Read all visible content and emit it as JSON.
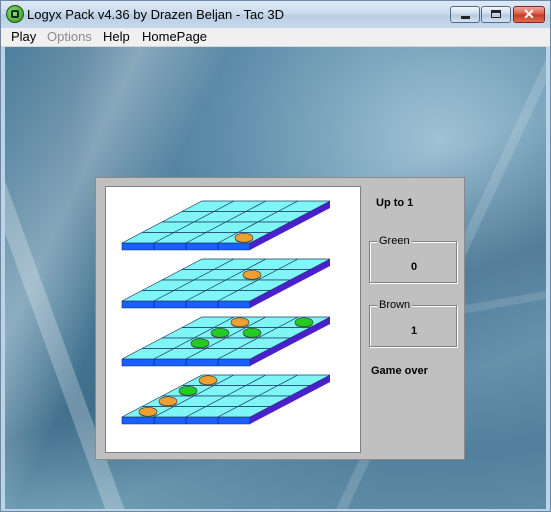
{
  "window": {
    "title": "Logyx Pack v4.36  by Drazen Beljan - Tac 3D"
  },
  "menu": [
    {
      "label": "Play",
      "enabled": true
    },
    {
      "label": "Options",
      "enabled": false
    },
    {
      "label": "Help",
      "enabled": true
    },
    {
      "label": "HomePage",
      "enabled": true
    }
  ],
  "game": {
    "goal_text": "Up to 1",
    "green": {
      "label": "Green",
      "score": "0"
    },
    "brown": {
      "label": "Brown",
      "score": "1"
    },
    "status_text": "Game over",
    "colors": {
      "board_top": "#7ff5f5",
      "board_front": "#1a5fff",
      "board_side": "#4a1fcc",
      "green_piece": "#22cc22",
      "brown_piece": "#f0a030"
    },
    "pieces": [
      {
        "layer": 0,
        "row": 3,
        "col": 3,
        "color": "brown"
      },
      {
        "layer": 1,
        "row": 1,
        "col": 2,
        "color": "brown"
      },
      {
        "layer": 2,
        "row": 0,
        "col": 1,
        "color": "brown"
      },
      {
        "layer": 2,
        "row": 1,
        "col": 1,
        "color": "green"
      },
      {
        "layer": 2,
        "row": 1,
        "col": 2,
        "color": "green"
      },
      {
        "layer": 2,
        "row": 0,
        "col": 3,
        "color": "green"
      },
      {
        "layer": 2,
        "row": 2,
        "col": 1,
        "color": "green"
      },
      {
        "layer": 3,
        "row": 0,
        "col": 0,
        "color": "brown"
      },
      {
        "layer": 3,
        "row": 1,
        "col": 0,
        "color": "green"
      },
      {
        "layer": 3,
        "row": 2,
        "col": 0,
        "color": "brown"
      },
      {
        "layer": 3,
        "row": 3,
        "col": 0,
        "color": "brown"
      }
    ]
  }
}
